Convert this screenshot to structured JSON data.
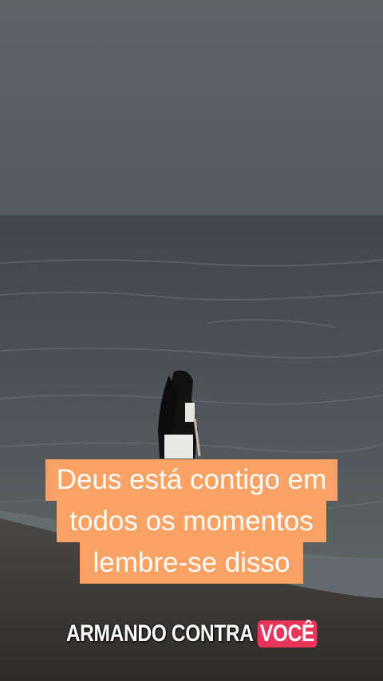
{
  "caption": {
    "lines": [
      "Deus está contigo em",
      "todos os momentos",
      "lembre-se disso"
    ],
    "background_color": "#f9a264",
    "text_color": "#ffffff"
  },
  "watermark": {
    "text": "ARMANDO CONTRA",
    "highlight": "VOCÊ",
    "highlight_color": "#e8355a"
  },
  "scene": {
    "sky_color": "#5a5d62",
    "sea_color": "#4a5154",
    "sand_color": "#3a3836"
  }
}
